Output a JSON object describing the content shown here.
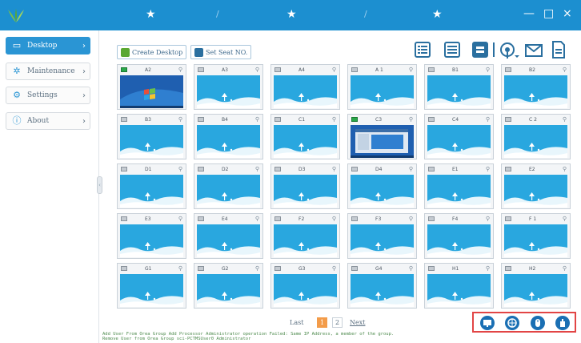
{
  "colors": {
    "topbar": "#1c8fd0",
    "accent": "#2a95d4",
    "screen": "#29a7df",
    "active_dot": "#2aa84a",
    "highlight_box": "#e24545",
    "page_current": "#f39c4a"
  },
  "topbar": {
    "stars": [
      "★",
      "★",
      "★"
    ],
    "slashes": [
      "/",
      "/"
    ],
    "minimize": "—",
    "maximize": "□",
    "close": "×"
  },
  "sidebar": {
    "items": [
      {
        "label": "Desktop",
        "icon": "monitor-icon",
        "glyph": "▭",
        "chevron": "›"
      },
      {
        "label": "Maintenance",
        "icon": "gear-icon",
        "glyph": "✲",
        "chevron": "›"
      },
      {
        "label": "Settings",
        "icon": "settings-icon",
        "glyph": "⚙",
        "chevron": "›"
      },
      {
        "label": "About",
        "icon": "info-icon",
        "glyph": "ⓘ",
        "chevron": "›"
      }
    ],
    "collapse": "‹"
  },
  "toolbar": {
    "create_desktop": "Create Desktop",
    "set_seat": "Set Seat NO."
  },
  "view_icons": [
    "list-icon",
    "detail-list-icon",
    "tile-view-icon",
    "broadcast-icon",
    "mail-icon",
    "document-icon"
  ],
  "tiles": [
    {
      "name": "A2",
      "screen": "desktop",
      "on": true
    },
    {
      "name": "A3",
      "screen": "idle",
      "on": false
    },
    {
      "name": "A4",
      "screen": "idle",
      "on": false
    },
    {
      "name": "A 1",
      "screen": "idle",
      "on": false
    },
    {
      "name": "B1",
      "screen": "idle",
      "on": false
    },
    {
      "name": "B2",
      "screen": "idle",
      "on": false
    },
    {
      "name": "B3",
      "screen": "idle",
      "on": false
    },
    {
      "name": "B4",
      "screen": "idle",
      "on": false
    },
    {
      "name": "C1",
      "screen": "idle",
      "on": false
    },
    {
      "name": "C3",
      "screen": "window",
      "on": true
    },
    {
      "name": "C4",
      "screen": "idle",
      "on": false
    },
    {
      "name": "C 2",
      "screen": "idle",
      "on": false
    },
    {
      "name": "D1",
      "screen": "idle",
      "on": false
    },
    {
      "name": "D2",
      "screen": "idle",
      "on": false
    },
    {
      "name": "D3",
      "screen": "idle",
      "on": false
    },
    {
      "name": "D4",
      "screen": "idle",
      "on": false
    },
    {
      "name": "E1",
      "screen": "idle",
      "on": false
    },
    {
      "name": "E2",
      "screen": "idle",
      "on": false
    },
    {
      "name": "E3",
      "screen": "idle",
      "on": false
    },
    {
      "name": "E4",
      "screen": "idle",
      "on": false
    },
    {
      "name": "F2",
      "screen": "idle",
      "on": false
    },
    {
      "name": "F3",
      "screen": "idle",
      "on": false
    },
    {
      "name": "F4",
      "screen": "idle",
      "on": false
    },
    {
      "name": "F   1",
      "screen": "idle",
      "on": false
    },
    {
      "name": "G1",
      "screen": "idle",
      "on": false
    },
    {
      "name": "G2",
      "screen": "idle",
      "on": false
    },
    {
      "name": "G3",
      "screen": "idle",
      "on": false
    },
    {
      "name": "G4",
      "screen": "idle",
      "on": false
    },
    {
      "name": "H1",
      "screen": "idle",
      "on": false
    },
    {
      "name": "H2",
      "screen": "idle",
      "on": false
    }
  ],
  "pager": {
    "last": "Last",
    "pages": [
      "1",
      "2"
    ],
    "current": "1",
    "next": "Next"
  },
  "actions": [
    "screen-broadcast-icon",
    "network-icon",
    "mouse-icon",
    "hand-icon"
  ],
  "log": {
    "line1": "Add User From Orea Group   Add Processor      Administrator        operation Failed: Same IP Address, a member of the group.",
    "line2": "Remove User from Orea Group sci-PCTMSUser0      Administrator"
  }
}
